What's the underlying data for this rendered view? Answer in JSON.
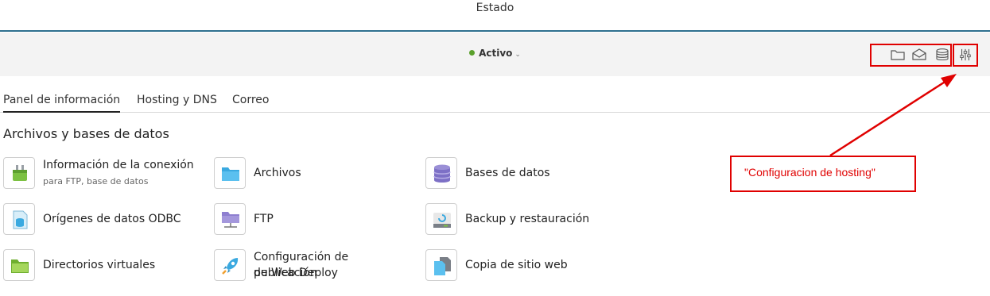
{
  "header": {
    "title": "Estado"
  },
  "status": {
    "label": "Activo",
    "dot_color": "#5aa02c"
  },
  "toolbar": {
    "icons": [
      "folder-icon",
      "mail-icon",
      "database-icon",
      "sliders-icon"
    ],
    "highlight_color": "#e00000"
  },
  "tabs": [
    {
      "label": "Panel de información",
      "active": true
    },
    {
      "label": "Hosting y DNS",
      "active": false
    },
    {
      "label": "Correo",
      "active": false
    }
  ],
  "section": {
    "title": "Archivos y bases de datos"
  },
  "items": [
    {
      "label": "Información de la conexión",
      "sublabel": "para FTP, base de datos",
      "icon": "plug-icon"
    },
    {
      "label": "Archivos",
      "icon": "folder-icon"
    },
    {
      "label": "Bases de datos",
      "icon": "database-icon"
    },
    {
      "label": "Orígenes de datos ODBC",
      "icon": "odbc-icon"
    },
    {
      "label": "FTP",
      "icon": "ftp-folder-icon"
    },
    {
      "label": "Backup y restauración",
      "icon": "backup-icon"
    },
    {
      "label": "Directorios virtuales",
      "icon": "virtual-directory-icon"
    },
    {
      "label_line1": "Configuración de publicación",
      "label_line2": "de Web Deploy",
      "icon": "rocket-icon"
    },
    {
      "label": "Copia de sitio web",
      "icon": "copy-site-icon"
    }
  ],
  "annotation": {
    "text": "\"Configuracion de hosting\"",
    "color": "#e00000"
  }
}
